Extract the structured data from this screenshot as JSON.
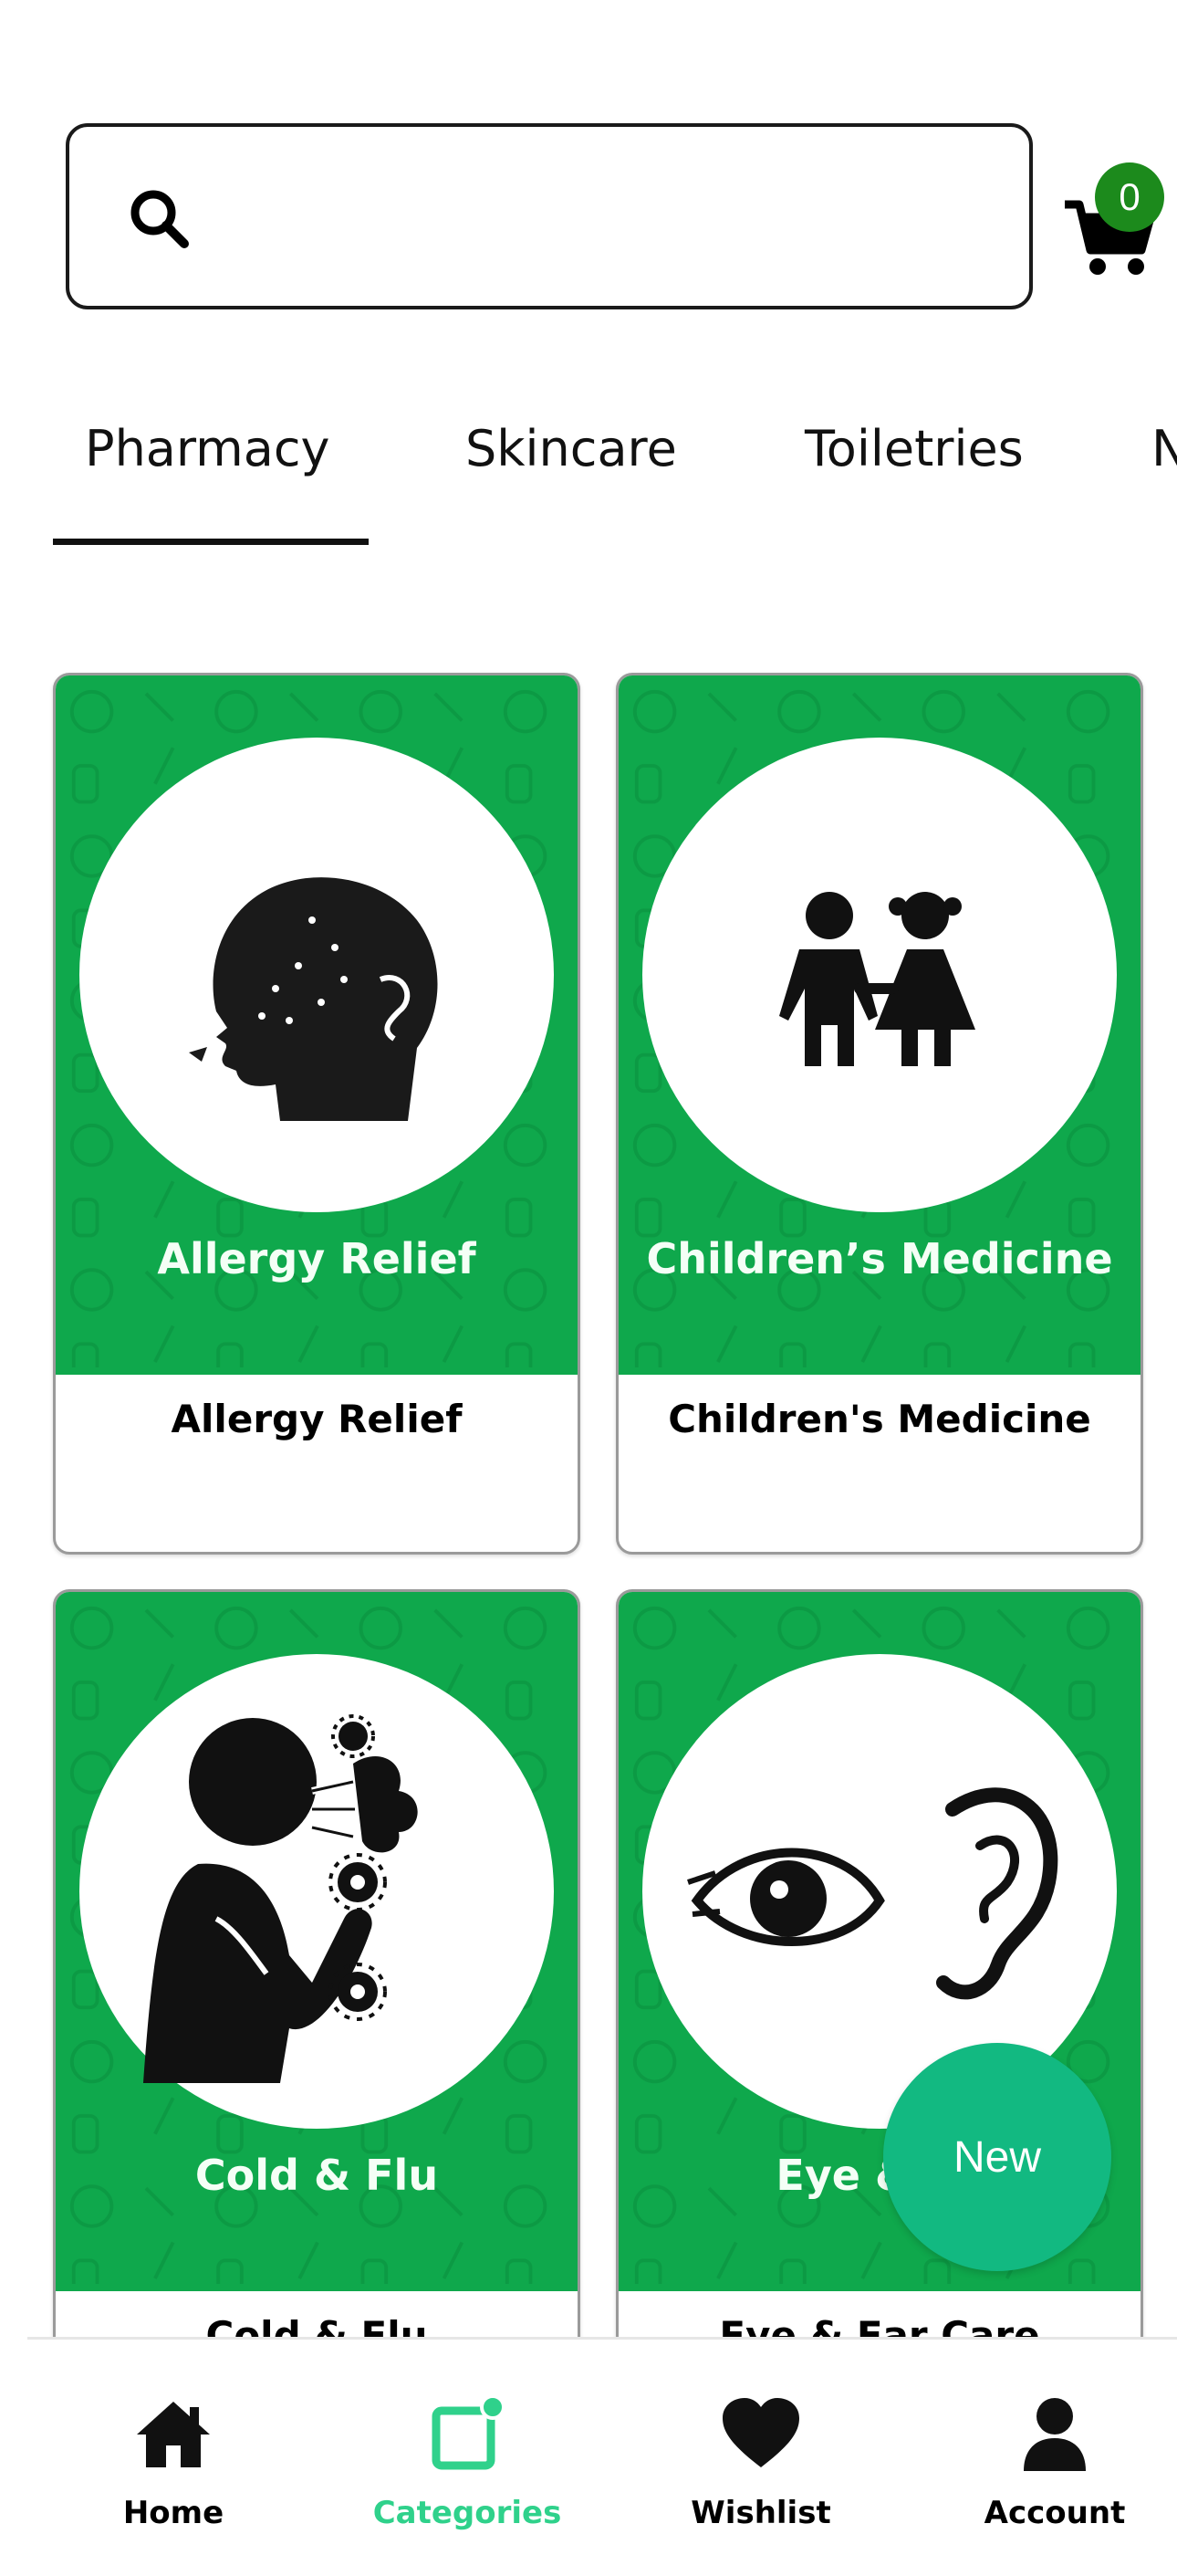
{
  "search": {
    "placeholder": "",
    "icon": "search-icon"
  },
  "cart": {
    "icon": "cart-icon",
    "count": "0",
    "badge_color": "#1c8a1c"
  },
  "tabs": [
    {
      "label": "Pharmacy",
      "active": true
    },
    {
      "label": "Skincare",
      "active": false
    },
    {
      "label": "Toiletries",
      "active": false
    },
    {
      "label": "N",
      "active": false
    }
  ],
  "categories": [
    {
      "art_title": "Allergy Relief",
      "name": "Allergy Relief",
      "icon": "sneezing-head-icon"
    },
    {
      "art_title": "Children’s Medicine",
      "name": "Children's Medicine",
      "icon": "children-icon"
    },
    {
      "art_title": "Cold & Flu",
      "name": "Cold & Flu",
      "icon": "coughing-person-icon"
    },
    {
      "art_title": "Eye & Ea",
      "name": "Eye & Ear Care",
      "icon": "eye-and-ear-icon"
    }
  ],
  "fab": {
    "label": "New",
    "color": "#12b981"
  },
  "bottom_nav": [
    {
      "label": "Home",
      "icon": "home-icon"
    },
    {
      "label": "Categories",
      "icon": "categories-icon",
      "active": true
    },
    {
      "label": "Wishlist",
      "icon": "heart-icon"
    },
    {
      "label": "Account",
      "icon": "user-icon"
    }
  ],
  "colors": {
    "card_green": "#0fa84c",
    "accent": "#2fd18b"
  }
}
